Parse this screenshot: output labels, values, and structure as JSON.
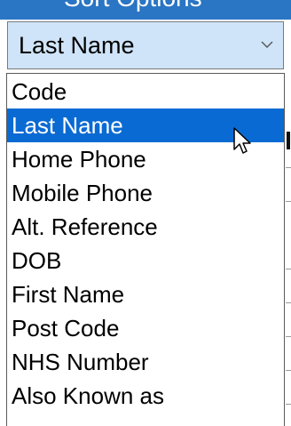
{
  "header": {
    "partial_text": "Sort Options"
  },
  "combo": {
    "selected_value": "Last Name",
    "arrow_icon": "chevron-down-icon"
  },
  "dropdown": {
    "selected_index": 1,
    "items": [
      {
        "label": "Code"
      },
      {
        "label": "Last Name"
      },
      {
        "label": "Home Phone"
      },
      {
        "label": "Mobile Phone"
      },
      {
        "label": "Alt. Reference"
      },
      {
        "label": "DOB"
      },
      {
        "label": "First Name"
      },
      {
        "label": "Post Code"
      },
      {
        "label": "NHS Number"
      },
      {
        "label": "Also Known as"
      }
    ]
  },
  "colors": {
    "header_bg": "#2a75c4",
    "combo_bg": "#cfe4f8",
    "selection_bg": "#0a6ad3"
  },
  "cursor": {
    "icon": "mouse-pointer-icon"
  }
}
